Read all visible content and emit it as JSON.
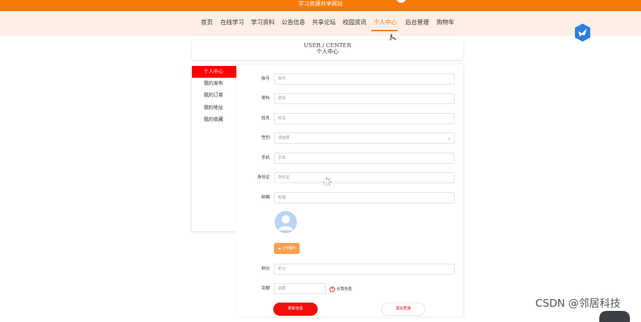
{
  "site": {
    "title": "学习资源共享网站"
  },
  "nav": {
    "items": [
      {
        "label": "首页"
      },
      {
        "label": "在线学习"
      },
      {
        "label": "学习资料"
      },
      {
        "label": "公告信息"
      },
      {
        "label": "共享论坛"
      },
      {
        "label": "校园资讯"
      },
      {
        "label": "个人中心",
        "active": true
      },
      {
        "label": "后台管理"
      },
      {
        "label": "购物车"
      }
    ]
  },
  "page_header": {
    "en": "USER / CENTER",
    "cn": "个人中心"
  },
  "sidebar": {
    "items": [
      {
        "label": "个人中心",
        "active": true
      },
      {
        "label": "我的发布"
      },
      {
        "label": "我的订单"
      },
      {
        "label": "我的地址"
      },
      {
        "label": "我的收藏"
      }
    ]
  },
  "form": {
    "fields": [
      {
        "label": "账号",
        "placeholder": "账号"
      },
      {
        "label": "密码",
        "placeholder": "密码"
      },
      {
        "label": "姓名",
        "placeholder": "姓名"
      },
      {
        "label": "性别",
        "placeholder": "请选择"
      },
      {
        "label": "手机",
        "placeholder": "手机"
      },
      {
        "label": "身份证",
        "placeholder": "身份证"
      },
      {
        "label": "邮箱",
        "placeholder": "邮箱"
      },
      {
        "label": "积分",
        "placeholder": "积分"
      },
      {
        "label": "余额",
        "placeholder": "余额"
      }
    ],
    "upload_label": "上传图片",
    "recharge_label": "点我充值",
    "update_label": "更新信息",
    "logout_label": "退出登录"
  },
  "watermark": "CSDN @邻居科技",
  "colors": {
    "brand": "#f77a09",
    "nav_bg": "#fdeee6",
    "active_red": "#ff0000"
  }
}
